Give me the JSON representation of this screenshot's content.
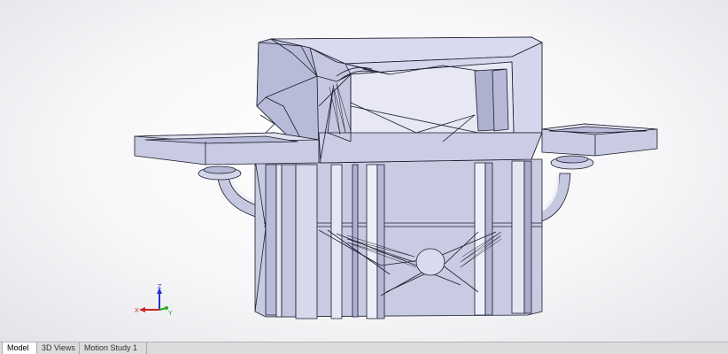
{
  "tabs": [
    {
      "label": "Model",
      "active": true
    },
    {
      "label": "3D Views",
      "active": false
    },
    {
      "label": "Motion Study 1",
      "active": false
    }
  ],
  "triad": {
    "x_label": "X",
    "y_label": "Y",
    "z_label": "Z"
  },
  "colors": {
    "model_fill": "#c9cbe3",
    "model_light": "#e4e5f3",
    "model_dark": "#9ea1c4",
    "edge": "#1a1a2a",
    "x_axis": "#cc2222",
    "y_axis": "#22aa22",
    "z_axis": "#2233cc"
  }
}
